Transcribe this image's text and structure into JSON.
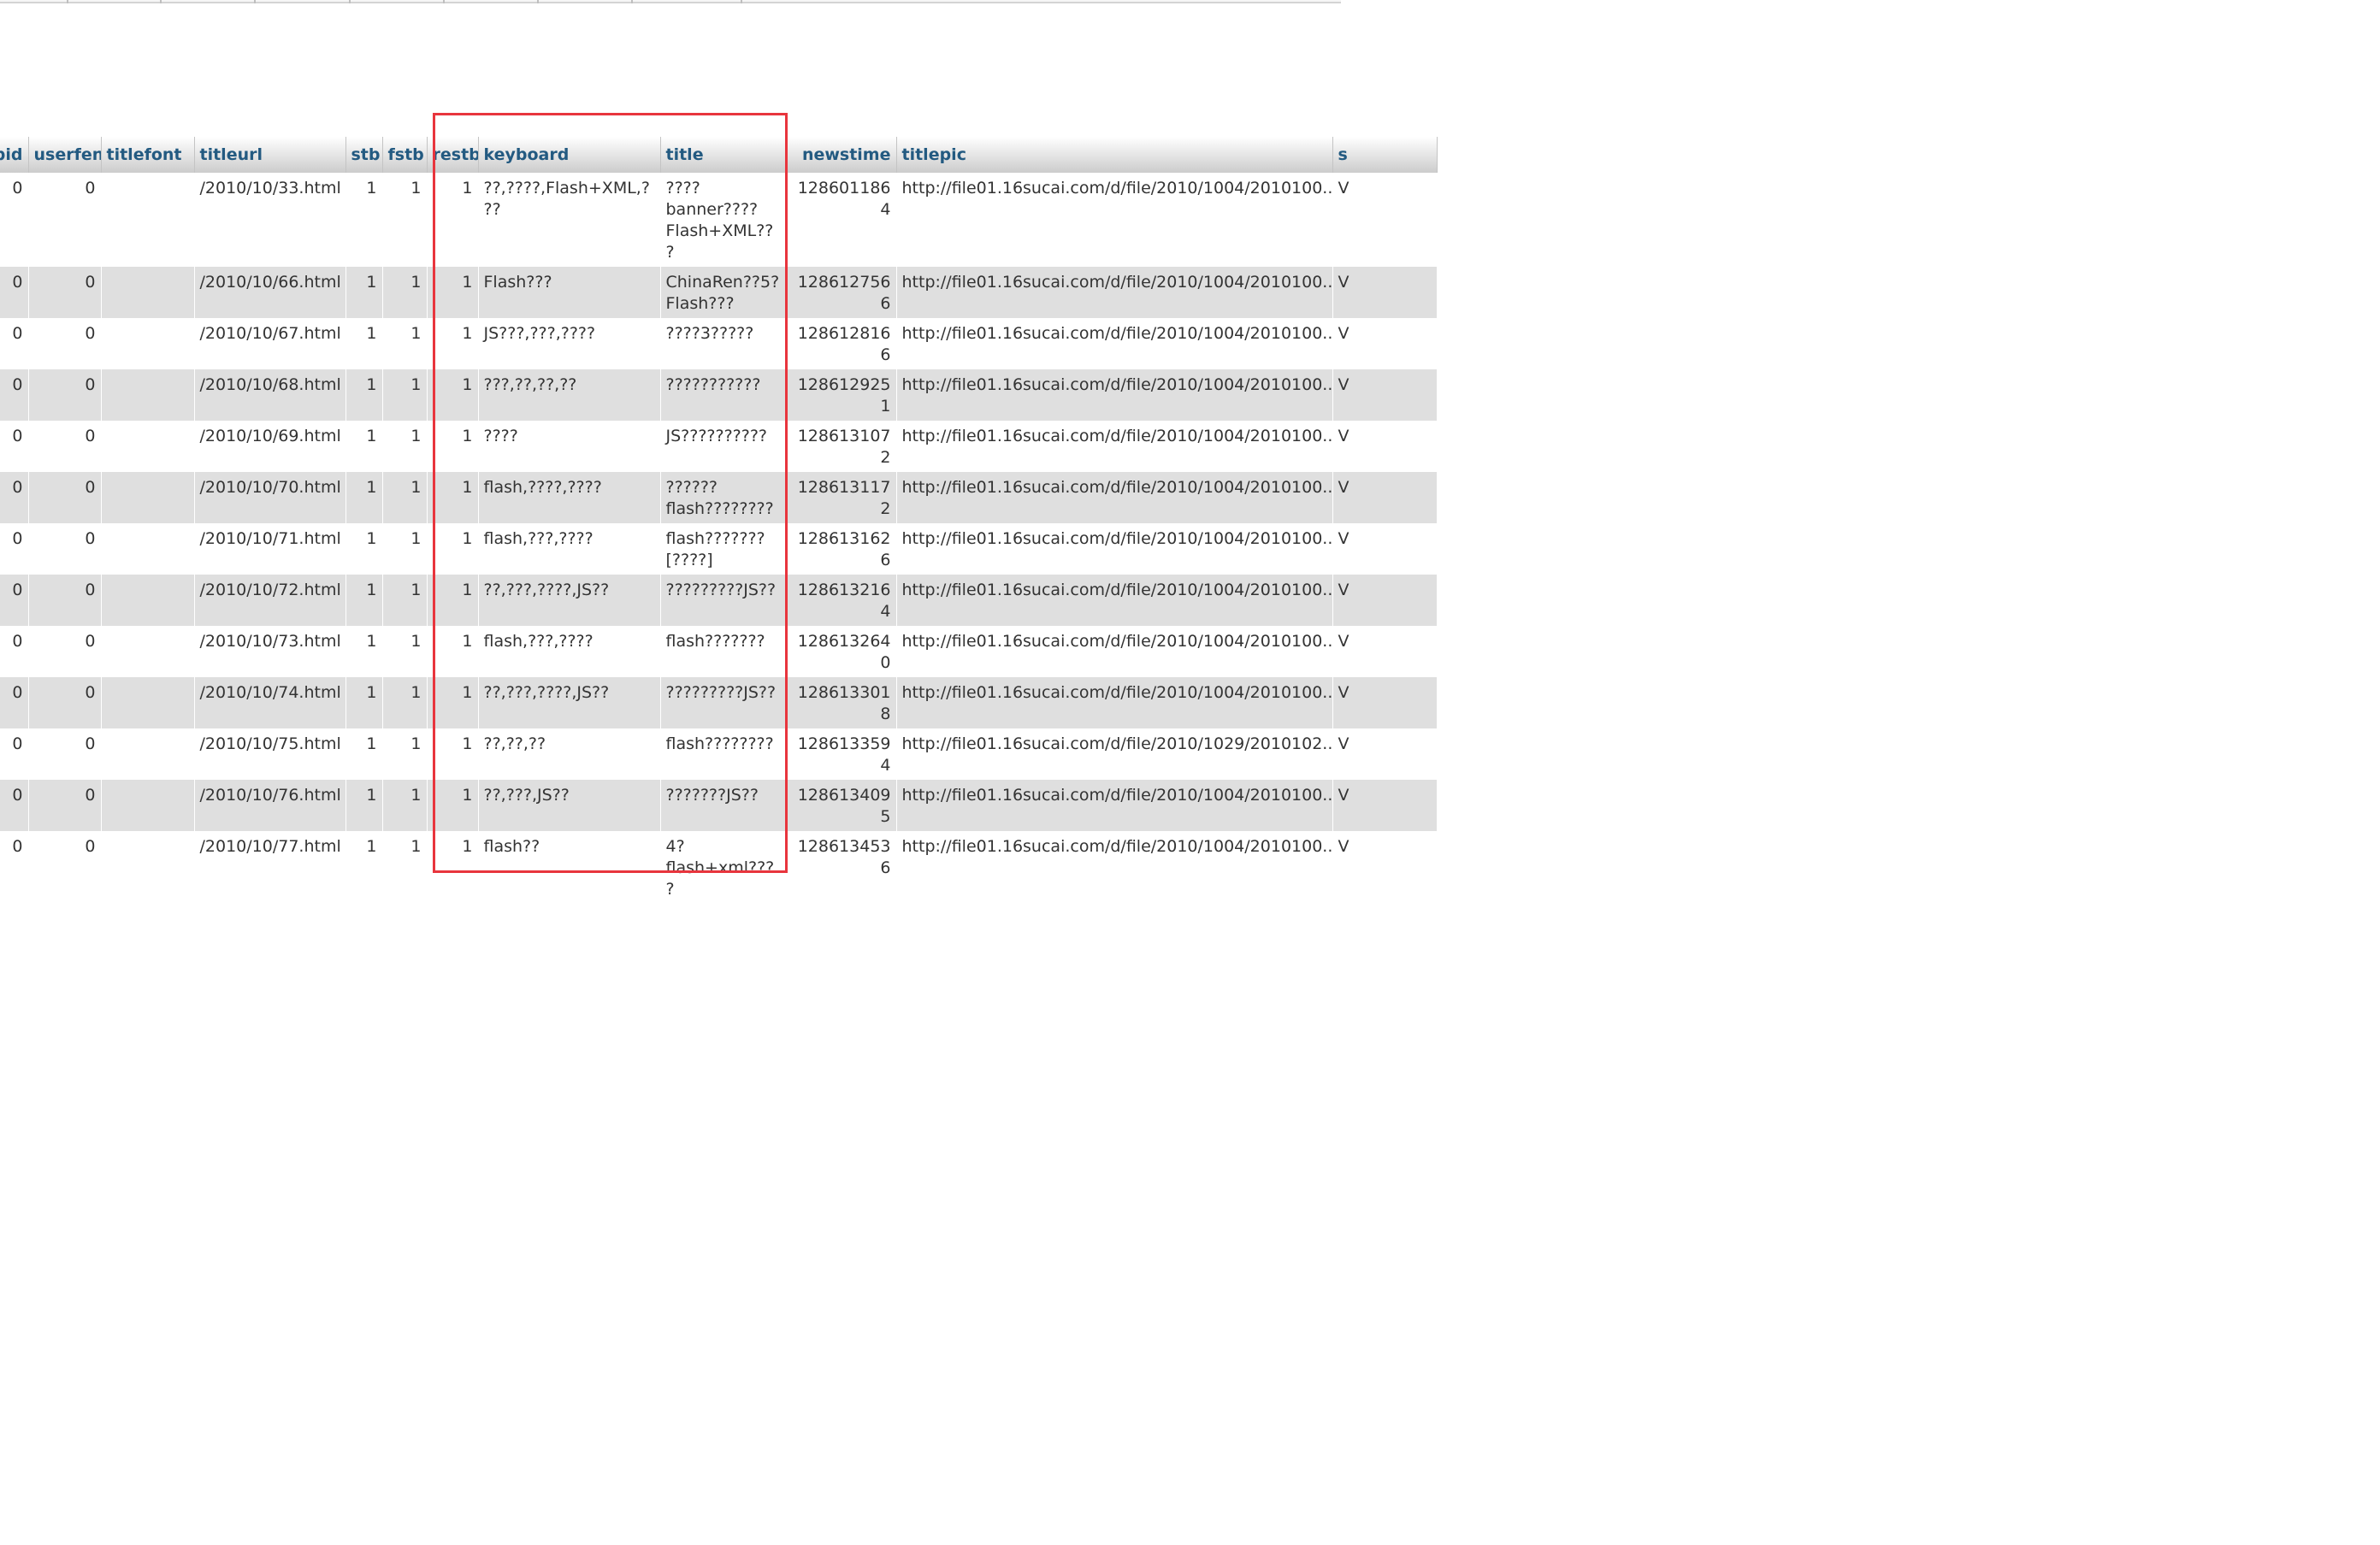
{
  "columns": [
    {
      "key": "pid",
      "label": "pid"
    },
    {
      "key": "userfen",
      "label": "userfen"
    },
    {
      "key": "titlefont",
      "label": "titlefont"
    },
    {
      "key": "titleurl",
      "label": "titleurl"
    },
    {
      "key": "stb",
      "label": "stb"
    },
    {
      "key": "fstb",
      "label": "fstb"
    },
    {
      "key": "restb",
      "label": "restb"
    },
    {
      "key": "keyboard",
      "label": "keyboard"
    },
    {
      "key": "title",
      "label": "title"
    },
    {
      "key": "newstime",
      "label": "newstime"
    },
    {
      "key": "titlepic",
      "label": "titlepic"
    },
    {
      "key": "next",
      "label": "s"
    }
  ],
  "rows": [
    {
      "pid": "0",
      "userfen": "0",
      "titlefont": "",
      "titleurl": "/2010/10/33.html",
      "stb": "1",
      "fstb": "1",
      "restb": "1",
      "keyboard": "??,????,Flash+XML,???",
      "title": "???? banner???? Flash+XML???",
      "newstime": "1286011864",
      "titlepic": "http://file01.16sucai.com/d/file/2010/1004/2010100...",
      "next": "V"
    },
    {
      "pid": "0",
      "userfen": "0",
      "titlefont": "",
      "titleurl": "/2010/10/66.html",
      "stb": "1",
      "fstb": "1",
      "restb": "1",
      "keyboard": "Flash???",
      "title": "ChinaRen??5? Flash???",
      "newstime": "1286127566",
      "titlepic": "http://file01.16sucai.com/d/file/2010/1004/2010100...",
      "next": "V"
    },
    {
      "pid": "0",
      "userfen": "0",
      "titlefont": "",
      "titleurl": "/2010/10/67.html",
      "stb": "1",
      "fstb": "1",
      "restb": "1",
      "keyboard": "JS???,???,????",
      "title": "????3?????",
      "newstime": "1286128166",
      "titlepic": "http://file01.16sucai.com/d/file/2010/1004/2010100...",
      "next": "V"
    },
    {
      "pid": "0",
      "userfen": "0",
      "titlefont": "",
      "titleurl": "/2010/10/68.html",
      "stb": "1",
      "fstb": "1",
      "restb": "1",
      "keyboard": "???,??,??,??",
      "title": "???????????",
      "newstime": "1286129251",
      "titlepic": "http://file01.16sucai.com/d/file/2010/1004/2010100...",
      "next": "V"
    },
    {
      "pid": "0",
      "userfen": "0",
      "titlefont": "",
      "titleurl": "/2010/10/69.html",
      "stb": "1",
      "fstb": "1",
      "restb": "1",
      "keyboard": "????",
      "title": "JS??????????",
      "newstime": "1286131072",
      "titlepic": "http://file01.16sucai.com/d/file/2010/1004/2010100...",
      "next": "V"
    },
    {
      "pid": "0",
      "userfen": "0",
      "titlefont": "",
      "titleurl": "/2010/10/70.html",
      "stb": "1",
      "fstb": "1",
      "restb": "1",
      "keyboard": "flash,????,????",
      "title": "?????? flash????????",
      "newstime": "1286131172",
      "titlepic": "http://file01.16sucai.com/d/file/2010/1004/2010100...",
      "next": "V"
    },
    {
      "pid": "0",
      "userfen": "0",
      "titlefont": "",
      "titleurl": "/2010/10/71.html",
      "stb": "1",
      "fstb": "1",
      "restb": "1",
      "keyboard": "flash,???,????",
      "title": "flash??????? [????]",
      "newstime": "1286131626",
      "titlepic": "http://file01.16sucai.com/d/file/2010/1004/2010100...",
      "next": "V"
    },
    {
      "pid": "0",
      "userfen": "0",
      "titlefont": "",
      "titleurl": "/2010/10/72.html",
      "stb": "1",
      "fstb": "1",
      "restb": "1",
      "keyboard": "??,???,????,JS??",
      "title": "?????????JS??",
      "newstime": "1286132164",
      "titlepic": "http://file01.16sucai.com/d/file/2010/1004/2010100...",
      "next": "V"
    },
    {
      "pid": "0",
      "userfen": "0",
      "titlefont": "",
      "titleurl": "/2010/10/73.html",
      "stb": "1",
      "fstb": "1",
      "restb": "1",
      "keyboard": "flash,???,????",
      "title": "flash???????",
      "newstime": "1286132640",
      "titlepic": "http://file01.16sucai.com/d/file/2010/1004/2010100...",
      "next": "V"
    },
    {
      "pid": "0",
      "userfen": "0",
      "titlefont": "",
      "titleurl": "/2010/10/74.html",
      "stb": "1",
      "fstb": "1",
      "restb": "1",
      "keyboard": "??,???,????,JS??",
      "title": "?????????JS??",
      "newstime": "1286133018",
      "titlepic": "http://file01.16sucai.com/d/file/2010/1004/2010100...",
      "next": "V"
    },
    {
      "pid": "0",
      "userfen": "0",
      "titlefont": "",
      "titleurl": "/2010/10/75.html",
      "stb": "1",
      "fstb": "1",
      "restb": "1",
      "keyboard": "??,??,??",
      "title": "flash????????",
      "newstime": "1286133594",
      "titlepic": "http://file01.16sucai.com/d/file/2010/1029/2010102...",
      "next": "V"
    },
    {
      "pid": "0",
      "userfen": "0",
      "titlefont": "",
      "titleurl": "/2010/10/76.html",
      "stb": "1",
      "fstb": "1",
      "restb": "1",
      "keyboard": "??,???,JS??",
      "title": "???????JS??",
      "newstime": "1286134095",
      "titlepic": "http://file01.16sucai.com/d/file/2010/1004/2010100...",
      "next": "V"
    },
    {
      "pid": "0",
      "userfen": "0",
      "titlefont": "",
      "titleurl": "/2010/10/77.html",
      "stb": "1",
      "fstb": "1",
      "restb": "1",
      "keyboard": "flash??",
      "title": "4? flash+xml????",
      "newstime": "1286134536",
      "titlepic": "http://file01.16sucai.com/d/file/2010/1004/2010100...",
      "next": "V"
    }
  ],
  "highlight": {
    "color": "#e8353d",
    "columns": [
      "restb",
      "keyboard",
      "title"
    ]
  },
  "colors": {
    "header_text": "#235a81",
    "row_even": "#dfdfdf",
    "row_odd": "#ffffff"
  }
}
